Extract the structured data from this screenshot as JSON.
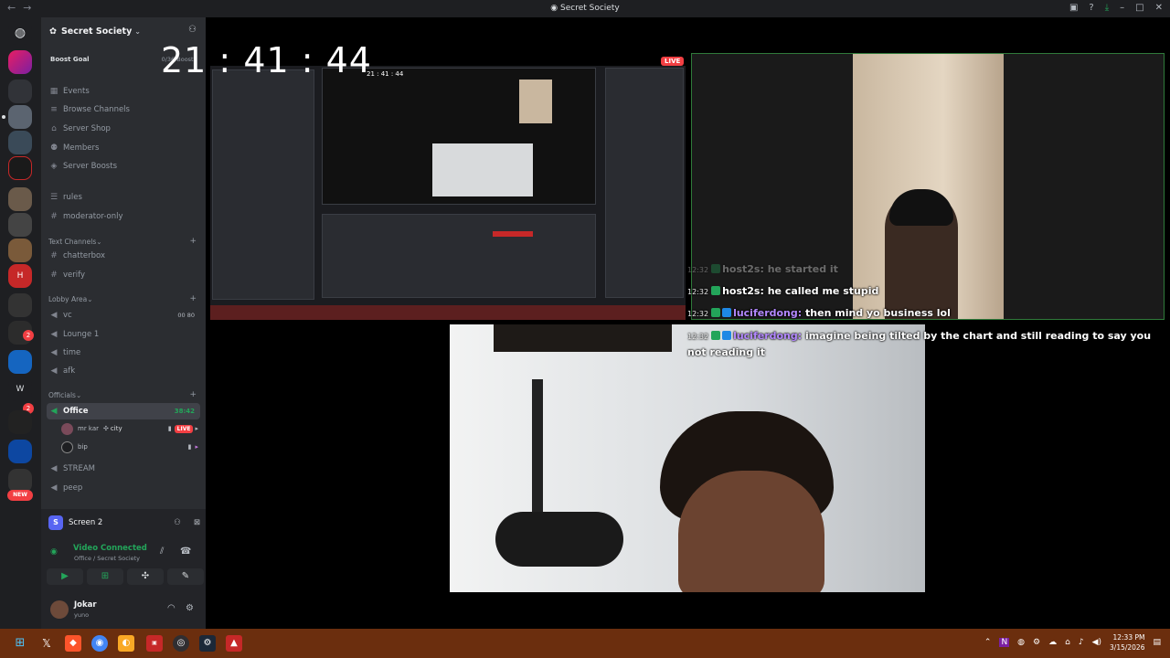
{
  "window": {
    "title": "Secret Society"
  },
  "server": {
    "name": "Secret Society",
    "boost_label": "Boost Goal",
    "boost_count": "0/36 Boosts"
  },
  "channels_top": [
    {
      "label": "Events",
      "icon": "calendar-icon"
    },
    {
      "label": "Browse Channels",
      "icon": "hash-list-icon"
    },
    {
      "label": "Server Shop",
      "icon": "shop-icon"
    },
    {
      "label": "Members",
      "icon": "members-icon"
    },
    {
      "label": "Server Boosts",
      "icon": "boost-icon"
    }
  ],
  "channels_misc": [
    {
      "label": "rules"
    },
    {
      "label": "moderator-only"
    }
  ],
  "categories": {
    "text": "Text Channels",
    "lobby": "Lobby Area",
    "officials": "Officials"
  },
  "text_channels": [
    {
      "label": "chatterbox"
    },
    {
      "label": "verify"
    }
  ],
  "lobby_channels": [
    {
      "label": "vc",
      "count_a": "00",
      "count_b": "80"
    },
    {
      "label": "Lounge 1"
    },
    {
      "label": "time"
    },
    {
      "label": "afk"
    }
  ],
  "officials": {
    "office": {
      "label": "Office",
      "time": "38:42"
    },
    "members": [
      {
        "name": "mr kar",
        "extra": "city",
        "live": "LIVE"
      },
      {
        "name": "bip"
      }
    ],
    "stream": "STREAM",
    "peep": "peep"
  },
  "voice_panel": {
    "screen_label": "Screen 2",
    "status": "Video Connected",
    "location": "Office / Secret Society",
    "user_name": "Jokar",
    "user_status": "yuno"
  },
  "rail": {
    "new_label": "NEW",
    "badge_a": "2",
    "badge_b": "2"
  },
  "stream": {
    "clock": "21 : 41 : 44",
    "live_label": "LIVE",
    "mini_clock": "21 : 41 : 44"
  },
  "chat": [
    {
      "ts": "12:32",
      "user": "host2s:",
      "text": "he started it",
      "faded": true,
      "badges": [
        "g"
      ]
    },
    {
      "ts": "12:32",
      "user": "host2s:",
      "text": "he called me stupid",
      "badges": [
        "g"
      ]
    },
    {
      "ts": "12:32",
      "user": "luciferdong:",
      "text": "then mind yo business lol",
      "badges": [
        "g",
        "b"
      ]
    },
    {
      "ts": "12:32",
      "user": "luciferdong:",
      "text": "imagine being tilted by the chart and still reading to say you not reading it",
      "badges": [
        "g",
        "b"
      ]
    }
  ],
  "taskbar": {
    "time": "12:33 PM",
    "date": "3/15/2026"
  }
}
